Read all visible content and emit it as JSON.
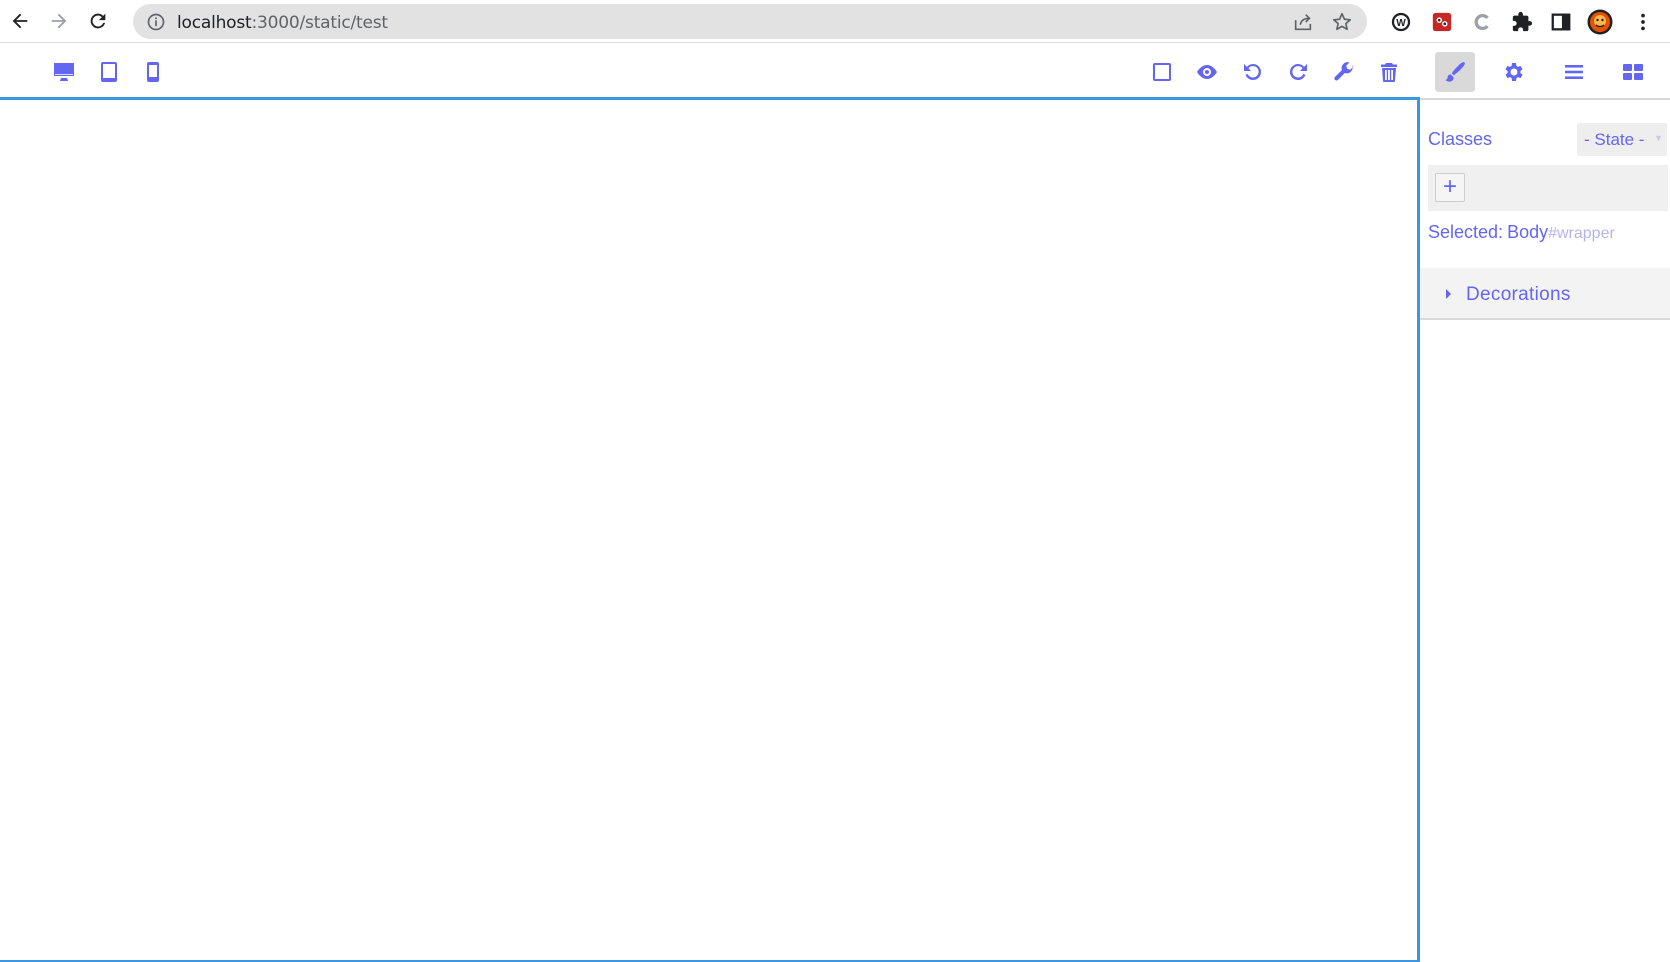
{
  "browser": {
    "url_host": "localhost",
    "url_path": ":3000/static/test"
  },
  "editor": {
    "devices": [
      "desktop",
      "tablet",
      "mobile"
    ],
    "toolbar_icons": [
      "sw-visibility-icon",
      "preview-icon",
      "undo-icon",
      "redo-icon",
      "code-icon",
      "trash-icon"
    ],
    "panel_tabs": [
      "style-manager",
      "settings",
      "layer-manager",
      "blocks"
    ],
    "active_panel": "style-manager"
  },
  "selector": {
    "classes_label": "Classes",
    "state_label": "- State -",
    "add_label": "+",
    "selected_label": "Selected:",
    "selected_name": "Body",
    "selected_id": "#wrapper"
  },
  "styles": {
    "sectors": [
      {
        "name": "Decorations"
      }
    ]
  },
  "colors": {
    "accent": "#6366f1",
    "frame_border": "#3b97e3"
  }
}
